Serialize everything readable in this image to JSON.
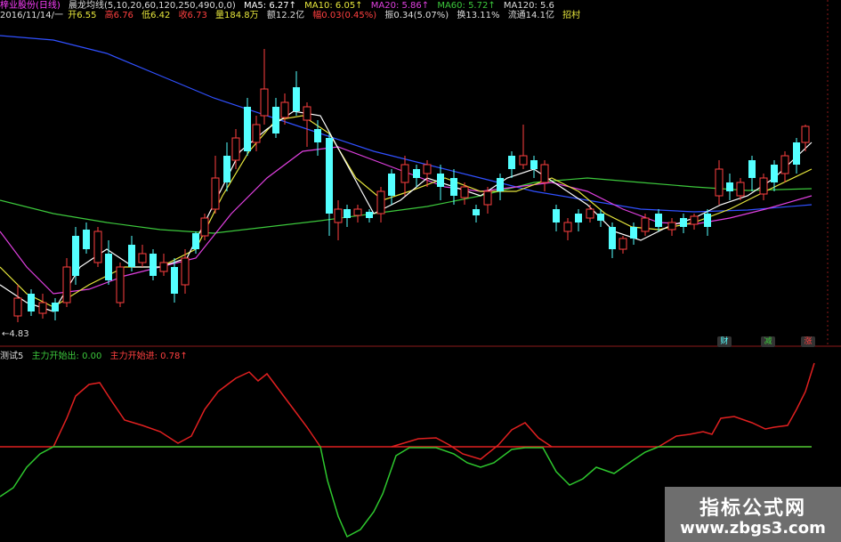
{
  "header": {
    "stock": "梓业股份(日线)",
    "indicator_name": "晨龙均线(5,10,20,60,120,250,490,0,0)",
    "ma5": "MA5: 6.27↑",
    "ma10": "MA10: 6.05↑",
    "ma20": "MA20: 5.86↑",
    "ma60": "MA60: 5.72↑",
    "ma120": "MA120: 5.6"
  },
  "ohlc": {
    "date": "2016/11/14/一",
    "open": "开6.55",
    "high": "高6.76",
    "low": "低6.42",
    "close": "收6.73",
    "volume": "量184.8万",
    "amount": "额12.2亿",
    "change": "幅0.03(0.45%)",
    "amplitude": "振0.34(5.07%)",
    "turnover": "换13.11%",
    "float": "流通14.1亿",
    "extra": "招村"
  },
  "low_marker": "←4.83",
  "badges": [
    "财",
    "减",
    "涨"
  ],
  "indicator": {
    "name": "测试5",
    "line1": "主力开始出: 0.00",
    "line2": "主力开始进: 0.78↑"
  },
  "watermark": {
    "title": "指标公式网",
    "url": "www.zbgs3.com"
  },
  "colors": {
    "up": "#ff4040",
    "down": "#54ffff",
    "ma5": "#ffffff",
    "ma10": "#e6e63c",
    "ma20": "#e040e0",
    "ma60": "#3cc83c",
    "ma120": "#3050ff",
    "red_line": "#e02020",
    "green_line": "#2ec82e"
  }
}
